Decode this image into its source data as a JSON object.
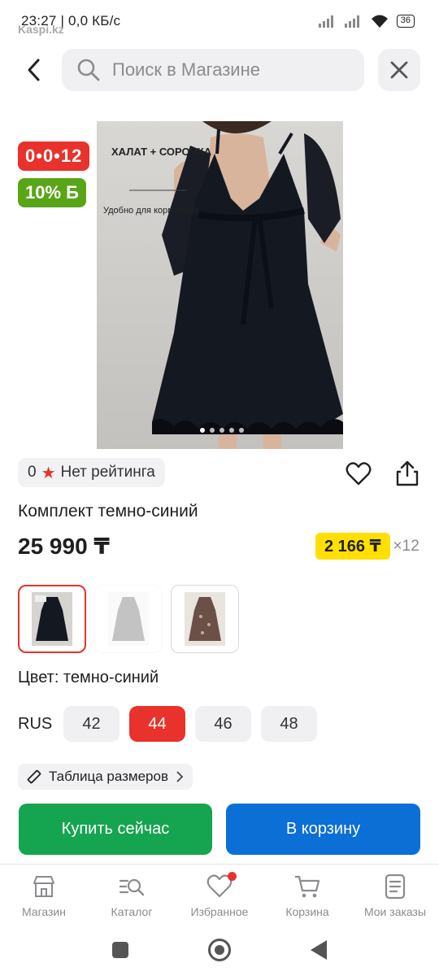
{
  "status": {
    "time": "23:27 | 0,0 КБ/с",
    "watermark": "Kaspi.kz",
    "battery": "36"
  },
  "header": {
    "search_placeholder": "Поиск в Магазине"
  },
  "product": {
    "image_caption": "ХАЛАТ + СОРОЧКА",
    "image_note": "Удобно для кормления",
    "countdown": "0•0•12",
    "bonus_badge": "10% Б",
    "rating_count": "0",
    "rating_text": "Нет рейтинга",
    "title": "Комплект темно-синий",
    "price": "25 990 ₸",
    "installment_amount": "2 166 ₸",
    "installment_multiplier": "×12",
    "color_label": "Цвет: темно-синий",
    "size_system": "RUS",
    "sizes": [
      "42",
      "44",
      "46",
      "48"
    ],
    "selected_size": "44",
    "size_chart_label": "Таблица размеров",
    "buy_now_label": "Купить сейчас",
    "add_to_cart_label": "В корзину",
    "dress_color": "#141821"
  },
  "tabbar": {
    "items": [
      {
        "label": "Магазин",
        "icon": "shop-icon"
      },
      {
        "label": "Каталог",
        "icon": "catalog-search-icon"
      },
      {
        "label": "Избранное",
        "icon": "heart-icon"
      },
      {
        "label": "Корзина",
        "icon": "cart-icon"
      },
      {
        "label": "Мои заказы",
        "icon": "orders-icon"
      }
    ]
  },
  "colors": {
    "accent_red": "#e8322b",
    "bonus_green": "#58a618",
    "buy_green": "#15a550",
    "cart_blue": "#0b6fd6",
    "installment_yellow": "#ffe000"
  }
}
